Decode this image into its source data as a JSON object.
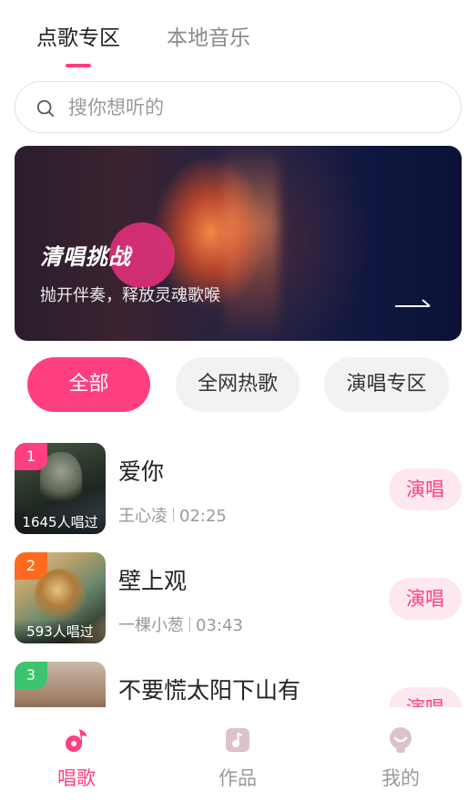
{
  "top_tabs": [
    {
      "label": "点歌专区",
      "active": true
    },
    {
      "label": "本地音乐",
      "active": false
    }
  ],
  "search": {
    "placeholder": "搜你想听的",
    "icon": "search-icon"
  },
  "banner": {
    "title": "清唱挑战",
    "subtitle": "抛开伴奏，释放灵魂歌喉",
    "icon": "arrow-right-icon"
  },
  "filters": [
    {
      "label": "全部",
      "active": true
    },
    {
      "label": "全网热歌",
      "active": false
    },
    {
      "label": "演唱专区",
      "active": false
    }
  ],
  "songs": [
    {
      "rank": "1",
      "rank_color": "#ff3f80",
      "title": "爱你",
      "artist": "王心凌",
      "duration": "02:25",
      "sung_count": "1645人唱过",
      "action": "演唱"
    },
    {
      "rank": "2",
      "rank_color": "#ff6a1f",
      "title": "壁上观",
      "artist": "一棵小葱",
      "duration": "03:43",
      "sung_count": "593人唱过",
      "action": "演唱"
    },
    {
      "rank": "3",
      "rank_color": "#3cc46e",
      "title": "不要慌太阳下山有",
      "artist": "",
      "duration": "",
      "sung_count": "",
      "action": "演唱"
    }
  ],
  "bottom_nav": [
    {
      "label": "唱歌",
      "icon": "music-note-icon",
      "active": true
    },
    {
      "label": "作品",
      "icon": "works-icon",
      "active": false
    },
    {
      "label": "我的",
      "icon": "profile-icon",
      "active": false
    }
  ],
  "colors": {
    "accent": "#ff3f80",
    "accent_light": "#fde8ef",
    "chip_bg": "#f2f2f2",
    "muted_text": "#9a9a9a"
  }
}
